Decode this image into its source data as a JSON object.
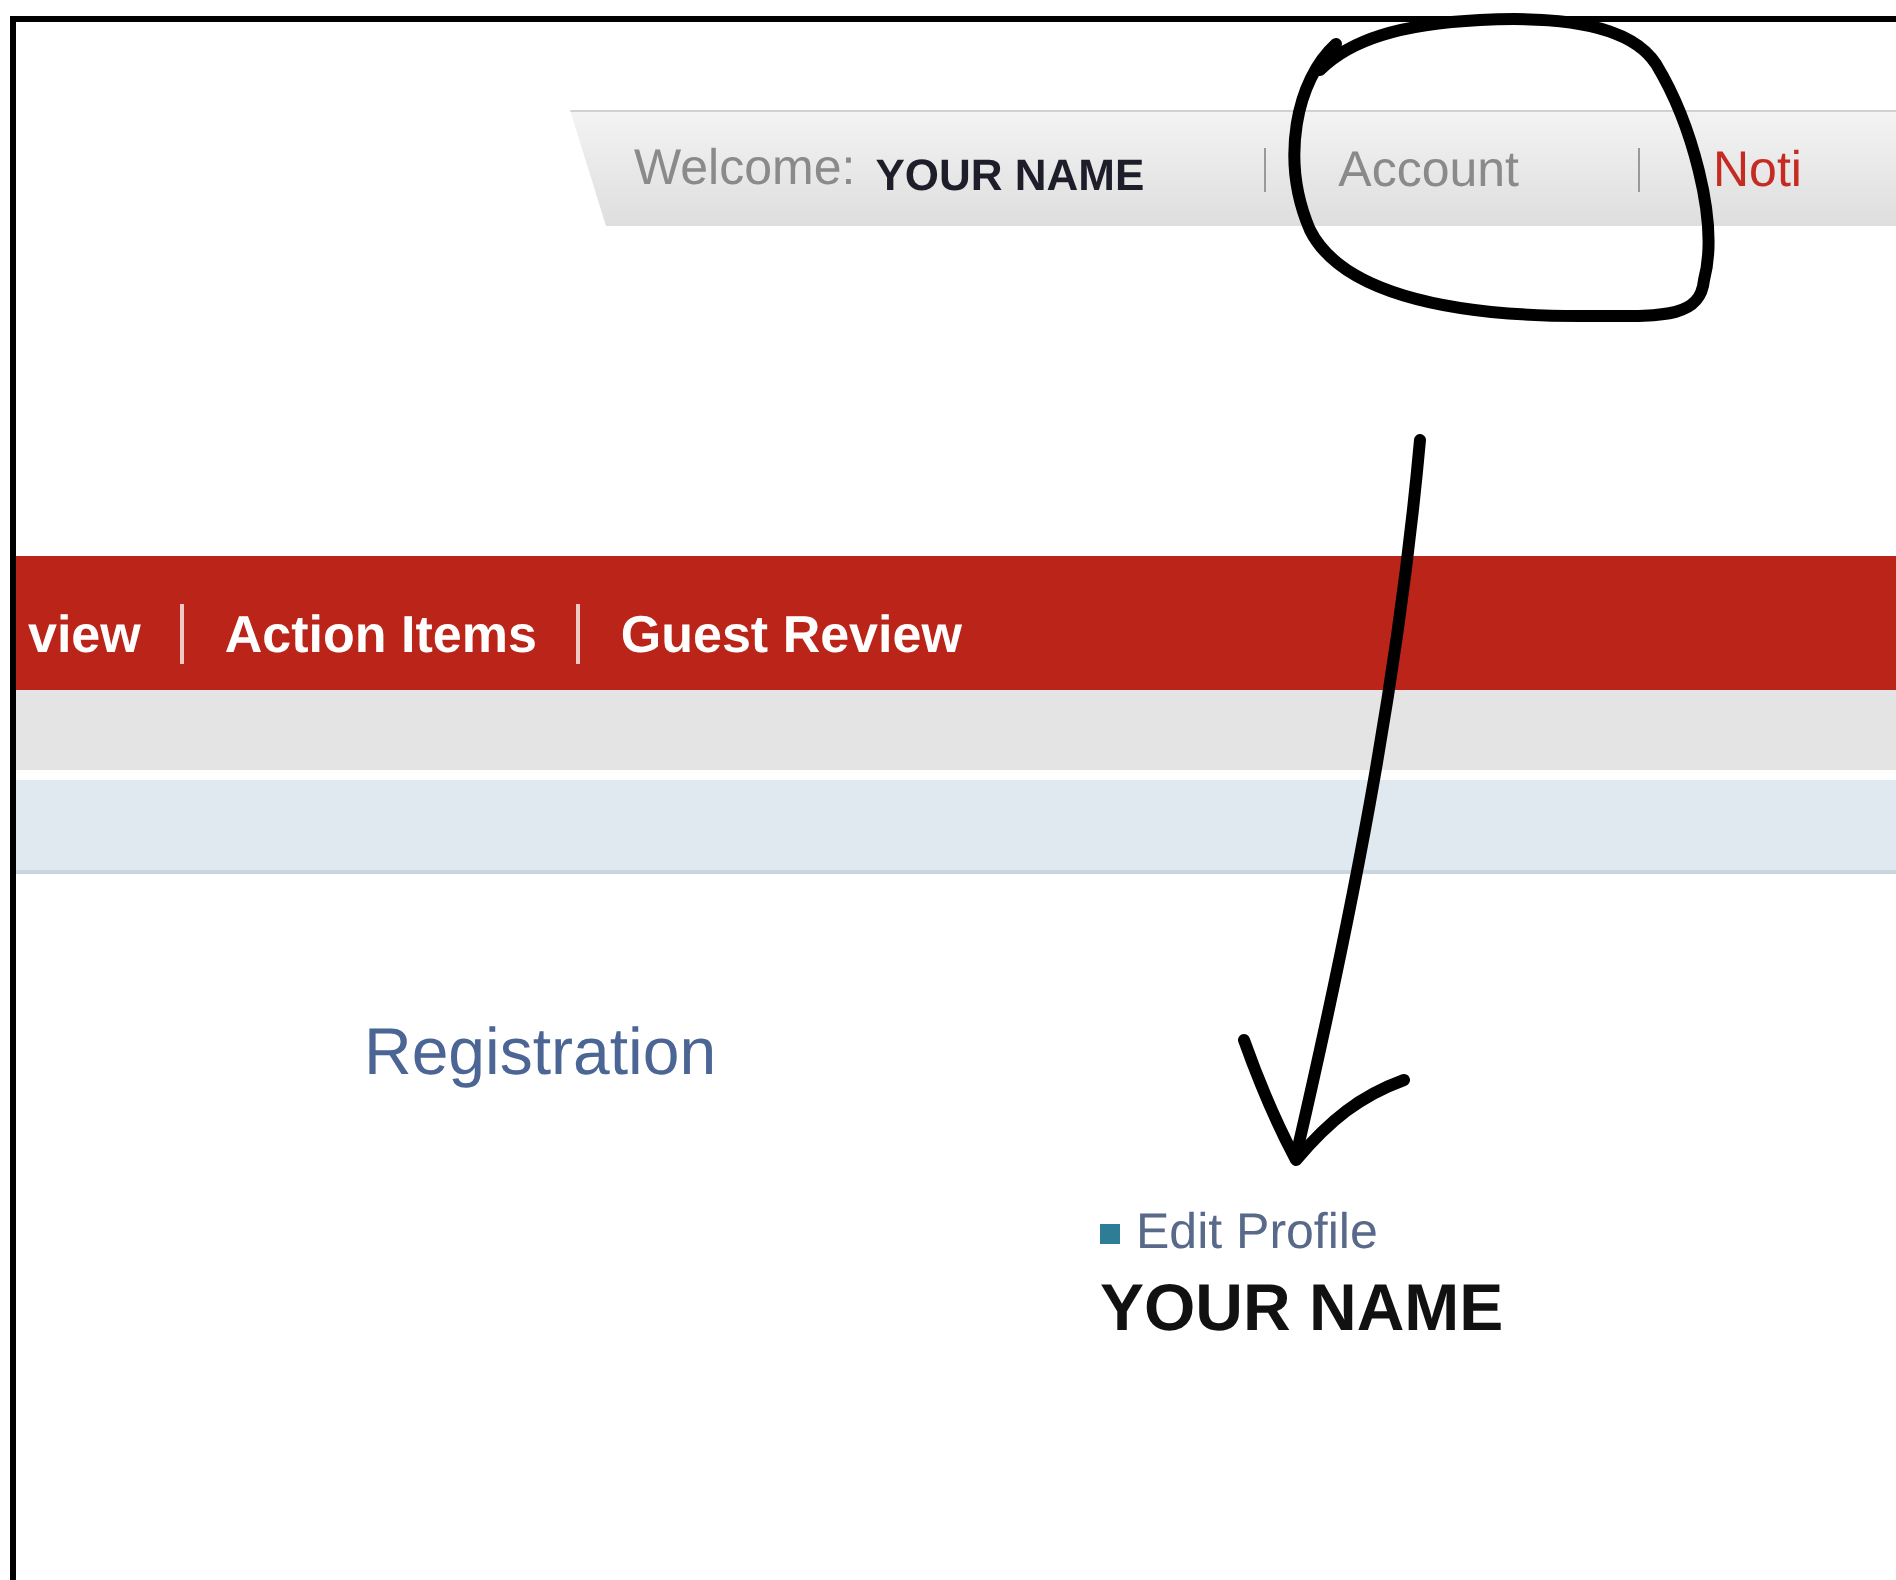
{
  "header": {
    "welcome_label": "Welcome:",
    "user_name": "YOUR NAME",
    "links": [
      {
        "label": "Account",
        "kind": "plain"
      },
      {
        "label": "Noti",
        "kind": "alert"
      }
    ]
  },
  "nav": {
    "items": [
      "view",
      "Action Items",
      "Guest Review"
    ]
  },
  "content": {
    "title": "Registration",
    "edit_link": "Edit Profile",
    "name": "YOUR NAME"
  }
}
